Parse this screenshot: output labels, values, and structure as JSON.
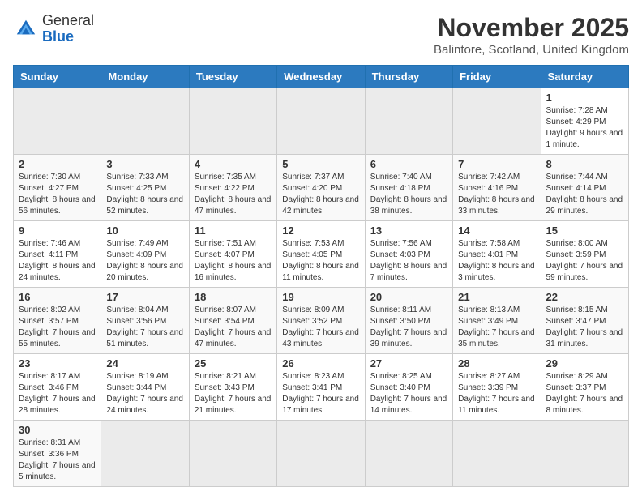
{
  "header": {
    "logo_general": "General",
    "logo_blue": "Blue",
    "month_title": "November 2025",
    "location": "Balintore, Scotland, United Kingdom"
  },
  "weekdays": [
    "Sunday",
    "Monday",
    "Tuesday",
    "Wednesday",
    "Thursday",
    "Friday",
    "Saturday"
  ],
  "weeks": [
    [
      {
        "day": "",
        "info": ""
      },
      {
        "day": "",
        "info": ""
      },
      {
        "day": "",
        "info": ""
      },
      {
        "day": "",
        "info": ""
      },
      {
        "day": "",
        "info": ""
      },
      {
        "day": "",
        "info": ""
      },
      {
        "day": "1",
        "info": "Sunrise: 7:28 AM\nSunset: 4:29 PM\nDaylight: 9 hours and 1 minute."
      }
    ],
    [
      {
        "day": "2",
        "info": "Sunrise: 7:30 AM\nSunset: 4:27 PM\nDaylight: 8 hours and 56 minutes."
      },
      {
        "day": "3",
        "info": "Sunrise: 7:33 AM\nSunset: 4:25 PM\nDaylight: 8 hours and 52 minutes."
      },
      {
        "day": "4",
        "info": "Sunrise: 7:35 AM\nSunset: 4:22 PM\nDaylight: 8 hours and 47 minutes."
      },
      {
        "day": "5",
        "info": "Sunrise: 7:37 AM\nSunset: 4:20 PM\nDaylight: 8 hours and 42 minutes."
      },
      {
        "day": "6",
        "info": "Sunrise: 7:40 AM\nSunset: 4:18 PM\nDaylight: 8 hours and 38 minutes."
      },
      {
        "day": "7",
        "info": "Sunrise: 7:42 AM\nSunset: 4:16 PM\nDaylight: 8 hours and 33 minutes."
      },
      {
        "day": "8",
        "info": "Sunrise: 7:44 AM\nSunset: 4:14 PM\nDaylight: 8 hours and 29 minutes."
      }
    ],
    [
      {
        "day": "9",
        "info": "Sunrise: 7:46 AM\nSunset: 4:11 PM\nDaylight: 8 hours and 24 minutes."
      },
      {
        "day": "10",
        "info": "Sunrise: 7:49 AM\nSunset: 4:09 PM\nDaylight: 8 hours and 20 minutes."
      },
      {
        "day": "11",
        "info": "Sunrise: 7:51 AM\nSunset: 4:07 PM\nDaylight: 8 hours and 16 minutes."
      },
      {
        "day": "12",
        "info": "Sunrise: 7:53 AM\nSunset: 4:05 PM\nDaylight: 8 hours and 11 minutes."
      },
      {
        "day": "13",
        "info": "Sunrise: 7:56 AM\nSunset: 4:03 PM\nDaylight: 8 hours and 7 minutes."
      },
      {
        "day": "14",
        "info": "Sunrise: 7:58 AM\nSunset: 4:01 PM\nDaylight: 8 hours and 3 minutes."
      },
      {
        "day": "15",
        "info": "Sunrise: 8:00 AM\nSunset: 3:59 PM\nDaylight: 7 hours and 59 minutes."
      }
    ],
    [
      {
        "day": "16",
        "info": "Sunrise: 8:02 AM\nSunset: 3:57 PM\nDaylight: 7 hours and 55 minutes."
      },
      {
        "day": "17",
        "info": "Sunrise: 8:04 AM\nSunset: 3:56 PM\nDaylight: 7 hours and 51 minutes."
      },
      {
        "day": "18",
        "info": "Sunrise: 8:07 AM\nSunset: 3:54 PM\nDaylight: 7 hours and 47 minutes."
      },
      {
        "day": "19",
        "info": "Sunrise: 8:09 AM\nSunset: 3:52 PM\nDaylight: 7 hours and 43 minutes."
      },
      {
        "day": "20",
        "info": "Sunrise: 8:11 AM\nSunset: 3:50 PM\nDaylight: 7 hours and 39 minutes."
      },
      {
        "day": "21",
        "info": "Sunrise: 8:13 AM\nSunset: 3:49 PM\nDaylight: 7 hours and 35 minutes."
      },
      {
        "day": "22",
        "info": "Sunrise: 8:15 AM\nSunset: 3:47 PM\nDaylight: 7 hours and 31 minutes."
      }
    ],
    [
      {
        "day": "23",
        "info": "Sunrise: 8:17 AM\nSunset: 3:46 PM\nDaylight: 7 hours and 28 minutes."
      },
      {
        "day": "24",
        "info": "Sunrise: 8:19 AM\nSunset: 3:44 PM\nDaylight: 7 hours and 24 minutes."
      },
      {
        "day": "25",
        "info": "Sunrise: 8:21 AM\nSunset: 3:43 PM\nDaylight: 7 hours and 21 minutes."
      },
      {
        "day": "26",
        "info": "Sunrise: 8:23 AM\nSunset: 3:41 PM\nDaylight: 7 hours and 17 minutes."
      },
      {
        "day": "27",
        "info": "Sunrise: 8:25 AM\nSunset: 3:40 PM\nDaylight: 7 hours and 14 minutes."
      },
      {
        "day": "28",
        "info": "Sunrise: 8:27 AM\nSunset: 3:39 PM\nDaylight: 7 hours and 11 minutes."
      },
      {
        "day": "29",
        "info": "Sunrise: 8:29 AM\nSunset: 3:37 PM\nDaylight: 7 hours and 8 minutes."
      }
    ],
    [
      {
        "day": "30",
        "info": "Sunrise: 8:31 AM\nSunset: 3:36 PM\nDaylight: 7 hours and 5 minutes."
      },
      {
        "day": "",
        "info": ""
      },
      {
        "day": "",
        "info": ""
      },
      {
        "day": "",
        "info": ""
      },
      {
        "day": "",
        "info": ""
      },
      {
        "day": "",
        "info": ""
      },
      {
        "day": "",
        "info": ""
      }
    ]
  ]
}
